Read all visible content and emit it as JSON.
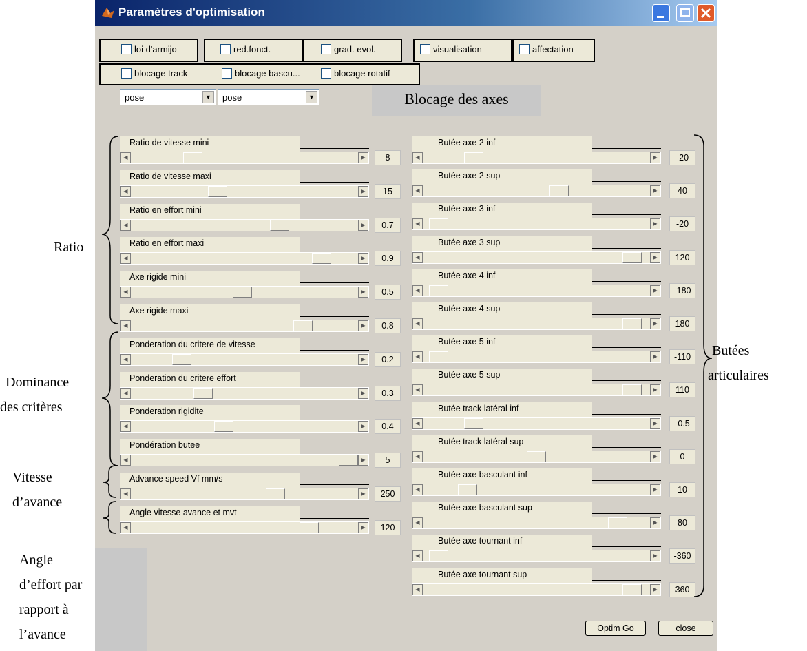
{
  "window": {
    "title": "Paramètres d'optimisation",
    "controls": {
      "minimize": "minimize-icon",
      "maximize": "maximize-icon",
      "close": "close-icon"
    }
  },
  "checkboxes": {
    "row1": [
      {
        "label": "loi d'armijo",
        "checked": false
      },
      {
        "label": "red.fonct.",
        "checked": false
      },
      {
        "label": "grad. evol.",
        "checked": false
      },
      {
        "label": "visualisation",
        "checked": false
      },
      {
        "label": "affectation",
        "checked": false
      }
    ],
    "row2": [
      {
        "label": "blocage track",
        "checked": false
      },
      {
        "label": "blocage bascu...",
        "checked": false
      },
      {
        "label": "blocage rotatif",
        "checked": false
      }
    ]
  },
  "popups": [
    {
      "value": "pose"
    },
    {
      "value": "pose"
    }
  ],
  "blocage_label": "Blocage des axes",
  "left_sliders": [
    {
      "label": "Ratio de vitesse mini",
      "value": "8",
      "pos": 0.25
    },
    {
      "label": "Ratio de vitesse maxi",
      "value": "15",
      "pos": 0.37
    },
    {
      "label": "Ratio en effort mini",
      "value": "0.7",
      "pos": 0.67
    },
    {
      "label": "Ratio en effort maxi",
      "value": "0.9",
      "pos": 0.87
    },
    {
      "label": "Axe rigide mini",
      "value": "0.5",
      "pos": 0.49
    },
    {
      "label": "Axe rigide maxi",
      "value": "0.8",
      "pos": 0.78
    },
    {
      "label": "Ponderation du critere de vitesse",
      "value": "0.2",
      "pos": 0.2
    },
    {
      "label": "Ponderation du critere effort",
      "value": "0.3",
      "pos": 0.3
    },
    {
      "label": "Ponderation rigidite",
      "value": "0.4",
      "pos": 0.4
    },
    {
      "label": "Pondération butee",
      "value": "5",
      "pos": 1.0
    },
    {
      "label": "Advance speed Vf mm/s",
      "value": "250",
      "pos": 0.65
    },
    {
      "label": "Angle vitesse avance et mvt",
      "value": "120",
      "pos": 0.81
    }
  ],
  "right_sliders": [
    {
      "label": "Butée axe 2 inf",
      "value": "-20",
      "pos": 0.2
    },
    {
      "label": "Butée axe 2 sup",
      "value": "40",
      "pos": 0.61
    },
    {
      "label": "Butée axe 3 inf",
      "value": "-20",
      "pos": 0.03
    },
    {
      "label": "Butée axe 3 sup",
      "value": "120",
      "pos": 0.96
    },
    {
      "label": "Butée axe 4 inf",
      "value": "-180",
      "pos": 0.03
    },
    {
      "label": "Butée axe 4 sup",
      "value": "180",
      "pos": 0.96
    },
    {
      "label": "Butée axe 5 inf",
      "value": "-110",
      "pos": 0.03
    },
    {
      "label": "Butée axe 5 sup",
      "value": "110",
      "pos": 0.96
    },
    {
      "label": "Butée track latéral inf",
      "value": "-0.5",
      "pos": 0.2
    },
    {
      "label": "Butée track latéral sup",
      "value": "0",
      "pos": 0.5
    },
    {
      "label": "Butée axe basculant inf",
      "value": "10",
      "pos": 0.17
    },
    {
      "label": "Butée axe basculant sup",
      "value": "80",
      "pos": 0.89
    },
    {
      "label": "Butée axe tournant inf",
      "value": "-360",
      "pos": 0.03
    },
    {
      "label": "Butée axe tournant sup",
      "value": "360",
      "pos": 0.96
    }
  ],
  "annotations": {
    "ratio": "Ratio",
    "dominance_1": "Dominance",
    "dominance_2": "des critères",
    "vitesse_1": "Vitesse",
    "vitesse_2": "d’avance",
    "angle_1": "Angle",
    "angle_2": "d’effort par",
    "angle_3": "rapport à",
    "angle_4": "l’avance",
    "butees_1": "Butées",
    "butees_2": "articulaires"
  },
  "buttons": {
    "optim_go": "Optim Go",
    "close": "close"
  }
}
